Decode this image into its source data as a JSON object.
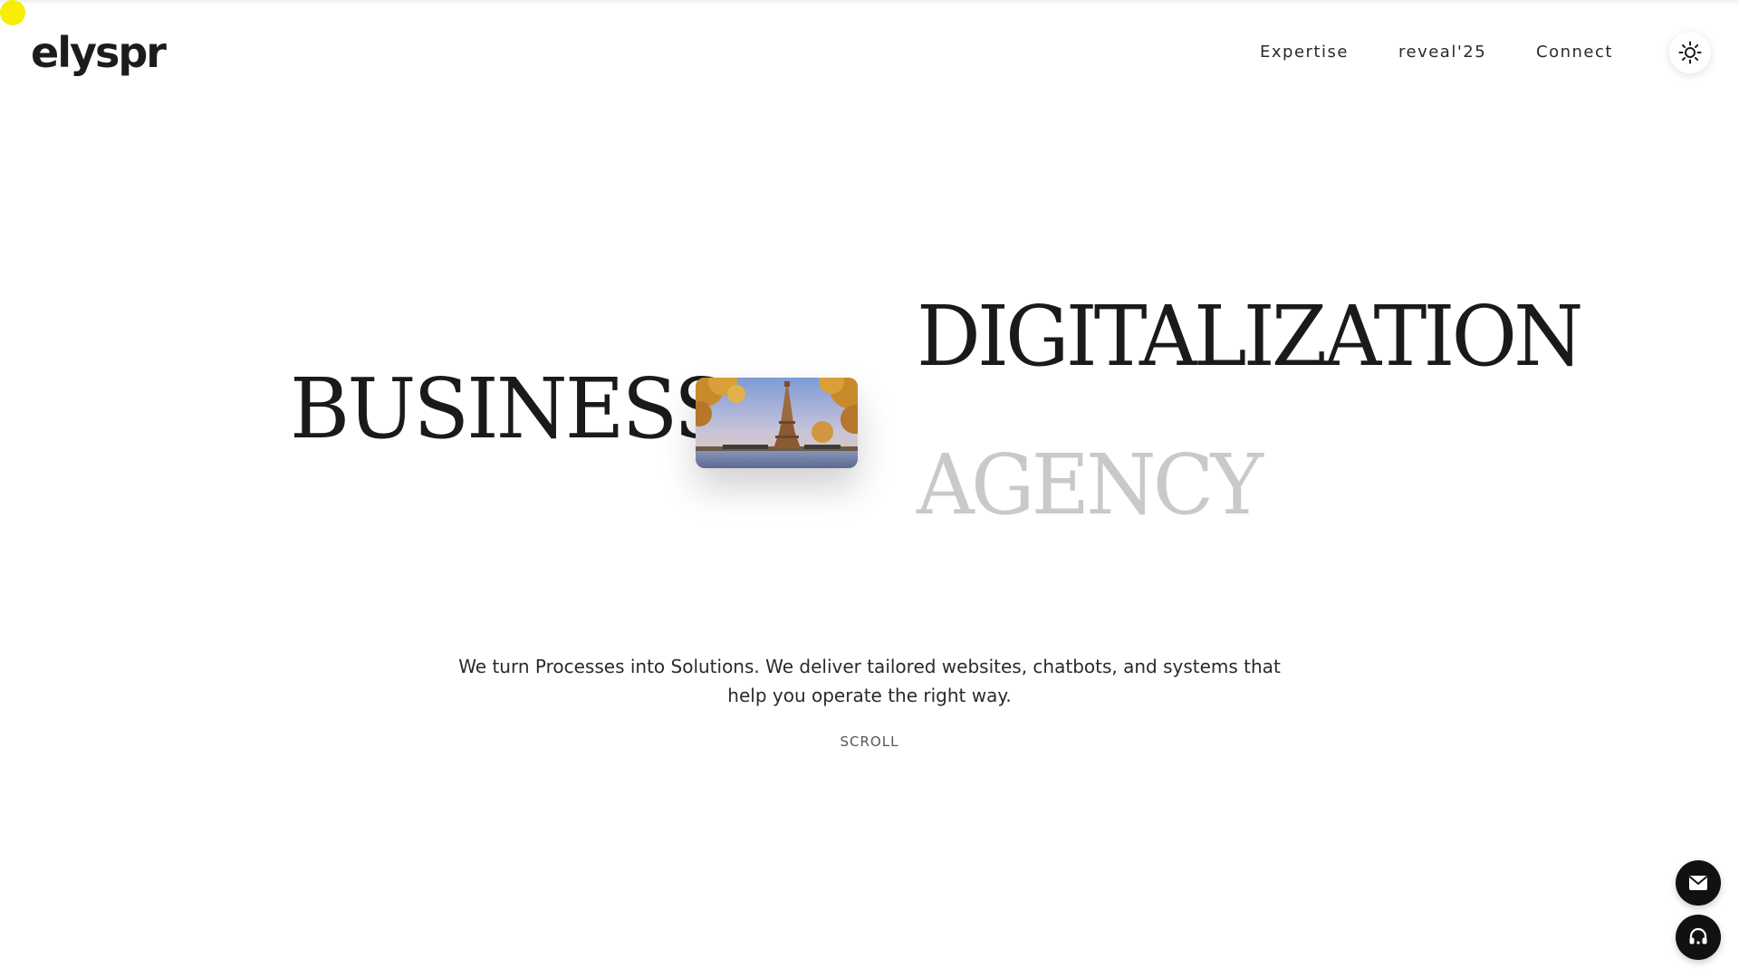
{
  "header": {
    "logo_text": "elyspr",
    "nav": [
      {
        "label": "Expertise"
      },
      {
        "label": "reveal'25"
      },
      {
        "label": "Connect"
      }
    ],
    "theme_toggle_icon": "sun-icon"
  },
  "hero": {
    "word_left": "BUSINESS",
    "word_right_top": "DIGITALIZATION",
    "word_right_bottom": "AGENCY",
    "image_alt_icon": "eiffel-tower-photo",
    "tagline_line1": "We turn Processes into Solutions. We deliver tailored websites, chatbots, and systems that",
    "tagline_line2": "help you operate the right way.",
    "scroll_label": "SCROLL"
  },
  "floating_actions": [
    {
      "icon": "mail-icon"
    },
    {
      "icon": "headset-icon"
    }
  ],
  "colors": {
    "text_dark": "#1a1a1a",
    "text_faded": "#c9c9c9",
    "fab_bg": "#111111",
    "cursor_highlight": "#f7ee00",
    "background": "#ffffff"
  }
}
